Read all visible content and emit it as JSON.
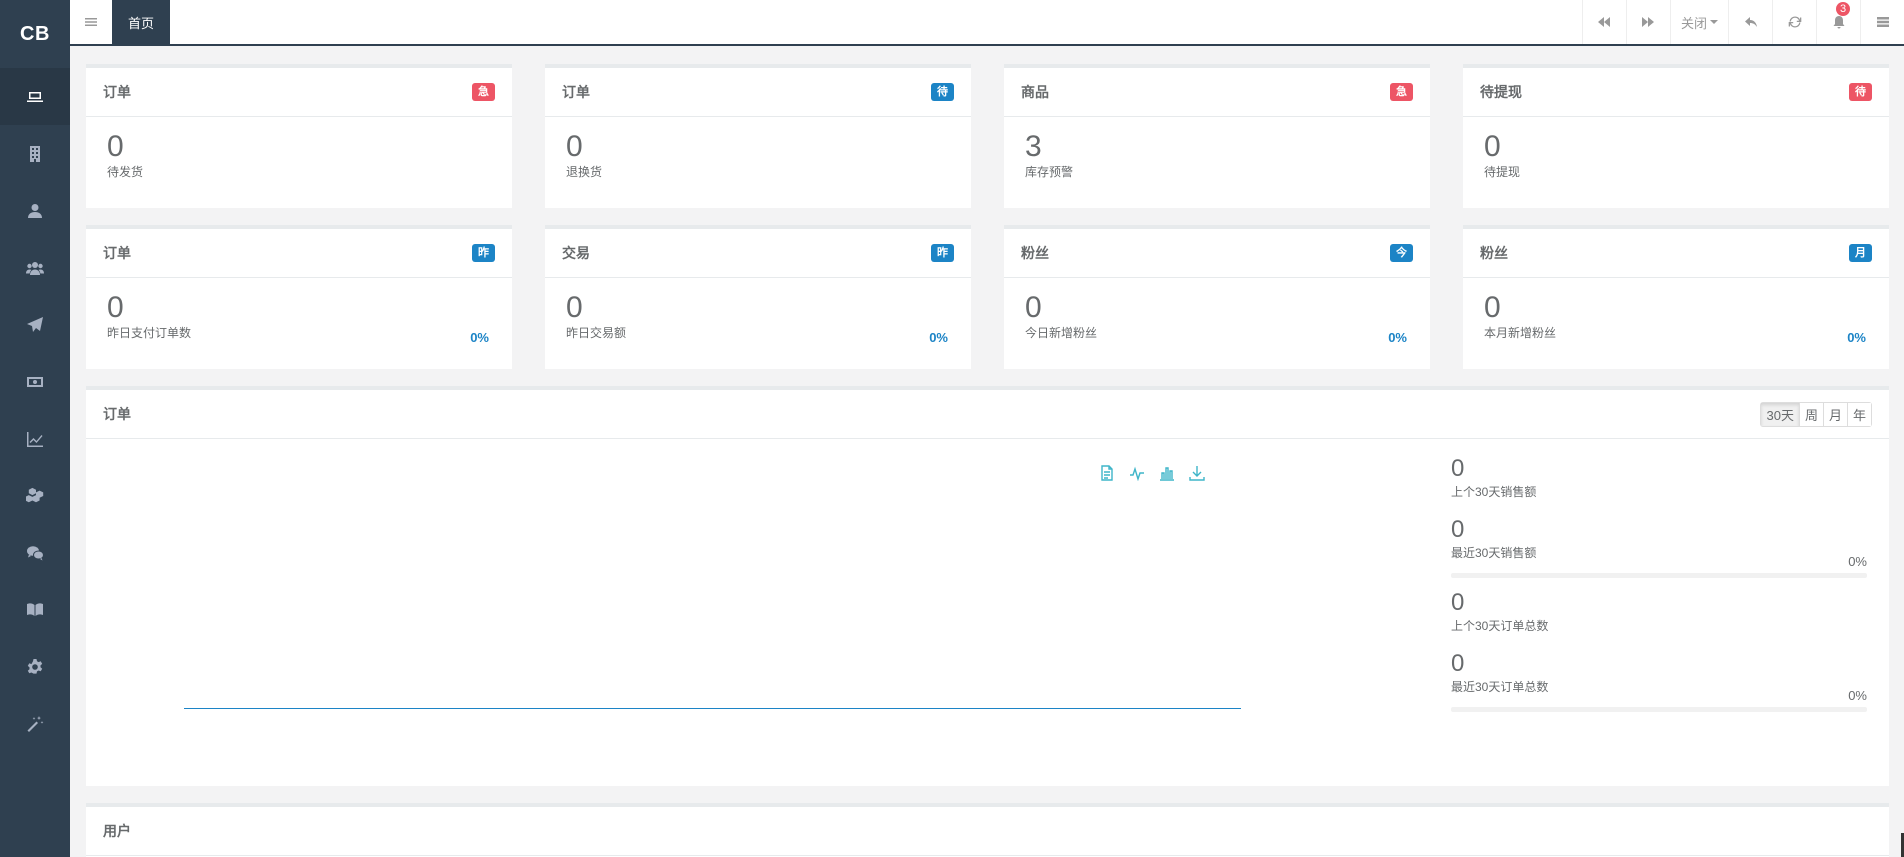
{
  "app": {
    "logo": "CB"
  },
  "sidebar": {
    "items": [
      {
        "icon": "laptop-icon",
        "active": true
      },
      {
        "icon": "building-icon"
      },
      {
        "icon": "user-icon"
      },
      {
        "icon": "users-icon"
      },
      {
        "icon": "paper-plane-icon"
      },
      {
        "icon": "money-icon"
      },
      {
        "icon": "line-chart-icon"
      },
      {
        "icon": "cubes-icon"
      },
      {
        "icon": "wechat-icon"
      },
      {
        "icon": "book-icon"
      },
      {
        "icon": "gear-icon"
      },
      {
        "icon": "magic-wand-icon"
      }
    ]
  },
  "topbar": {
    "home_tab": "首页",
    "close_label": "关闭",
    "notification_count": "3"
  },
  "summary_cards": [
    {
      "title": "订单",
      "badge": "急",
      "badge_color": "#ed5565",
      "value": "0",
      "label": "待发货"
    },
    {
      "title": "订单",
      "badge": "待",
      "badge_color": "#1c84c6",
      "value": "0",
      "label": "退换货"
    },
    {
      "title": "商品",
      "badge": "急",
      "badge_color": "#ed5565",
      "value": "3",
      "label": "库存预警"
    },
    {
      "title": "待提现",
      "badge": "待",
      "badge_color": "#ed5565",
      "value": "0",
      "label": "待提现"
    }
  ],
  "trend_cards": [
    {
      "title": "订单",
      "badge": "昨",
      "value": "0",
      "label": "昨日支付订单数",
      "percent": "0%"
    },
    {
      "title": "交易",
      "badge": "昨",
      "value": "0",
      "label": "昨日交易额",
      "percent": "0%"
    },
    {
      "title": "粉丝",
      "badge": "今",
      "value": "0",
      "label": "今日新增粉丝",
      "percent": "0%"
    },
    {
      "title": "粉丝",
      "badge": "月",
      "value": "0",
      "label": "本月新增粉丝",
      "percent": "0%"
    }
  ],
  "orders_panel": {
    "title": "订单",
    "ranges": [
      "30天",
      "周",
      "月",
      "年"
    ],
    "selected_range": "30天",
    "tools": [
      "data-view-icon",
      "line-chart-icon",
      "bar-chart-icon",
      "download-icon"
    ],
    "stats": [
      {
        "value": "0",
        "label": "上个30天销售额"
      },
      {
        "value": "0",
        "label": "最近30天销售额",
        "percent": "0%",
        "progress": 0
      },
      {
        "value": "0",
        "label": "上个30天订单总数"
      },
      {
        "value": "0",
        "label": "最近30天订单总数",
        "percent": "0%",
        "progress": 0
      }
    ]
  },
  "users_panel": {
    "title": "用户"
  }
}
